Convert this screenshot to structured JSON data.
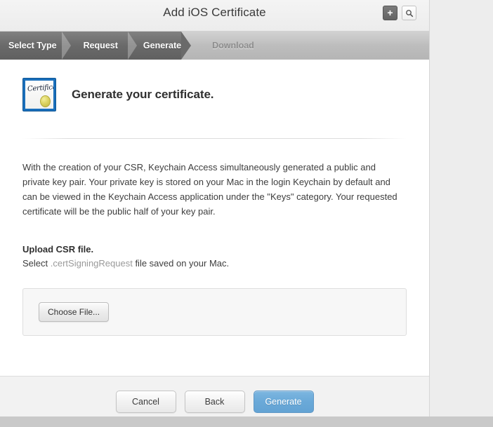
{
  "titlebar": {
    "title": "Add iOS Certificate",
    "add_button_glyph": "+",
    "add_button_name": "add-icon",
    "search_button_name": "search-icon"
  },
  "steps": [
    {
      "label": "Select Type",
      "state": "done"
    },
    {
      "label": "Request",
      "state": "done"
    },
    {
      "label": "Generate",
      "state": "current"
    },
    {
      "label": "Download",
      "state": "todo"
    }
  ],
  "hero": {
    "icon_name": "certificate-icon",
    "icon_script_text": "Certificate",
    "heading": "Generate your certificate."
  },
  "content": {
    "body_copy": "With the creation of your CSR, Keychain Access simultaneously generated a public and private key pair. Your private key is stored on your Mac in the login Keychain by default and can be viewed in the Keychain Access application under the \"Keys\" category. Your requested certificate will be the public half of your key pair.",
    "section_title": "Upload CSR file.",
    "section_sub_prefix": "Select ",
    "section_sub_filetype": ".certSigningRequest",
    "section_sub_suffix": " file saved on your Mac.",
    "choose_file_label": "Choose File..."
  },
  "footer": {
    "cancel_label": "Cancel",
    "back_label": "Back",
    "generate_label": "Generate"
  },
  "colors": {
    "primary_button": "#6aa9d8",
    "step_active": "#6a6a6a",
    "step_inactive_text": "#8d8d8d",
    "panel": "#ffffff",
    "page_background": "#ededed",
    "cert_icon_frame": "#1a6fbb",
    "cert_seal": "#ddd463"
  }
}
